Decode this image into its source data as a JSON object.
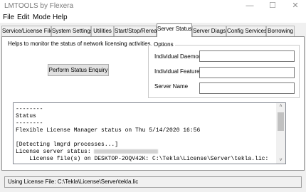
{
  "window": {
    "title": "LMTOOLS by Flexera",
    "minimize_glyph": "—",
    "maximize_glyph": "☐",
    "close_glyph": "✕"
  },
  "menu": [
    "File",
    "Edit",
    "Mode",
    "Help"
  ],
  "tabs": [
    {
      "label": "Service/License File"
    },
    {
      "label": "System Settings"
    },
    {
      "label": "Utilities"
    },
    {
      "label": "Start/Stop/Reread"
    },
    {
      "label": "Server Status",
      "active": true
    },
    {
      "label": "Server Diags"
    },
    {
      "label": "Config Services"
    },
    {
      "label": "Borrowing"
    }
  ],
  "server_status": {
    "description": "Helps to monitor the status of network licensing activities",
    "enquiry_button": "Perform Status Enquiry",
    "options": {
      "legend": "Options",
      "daemon_label": "Individual Daemon",
      "daemon_value": "",
      "feature_label": "Individual Feature",
      "feature_value": "",
      "server_label": "Server Name",
      "server_value": ""
    },
    "output": {
      "line1": "--------",
      "line2": "Status",
      "line3": "--------",
      "line4": "Flexible License Manager status on Thu 5/14/2020 16:56",
      "line5": "",
      "line6": "[Detecting lmgrd processes...]",
      "line7_prefix": "License server status: ",
      "line8": "    License file(s) on DESKTOP-2OQV42K: C:\\Tekla\\License\\Server\\tekla.lic:"
    },
    "scroll_up": "˄",
    "scroll_down": "˅"
  },
  "status_bar": {
    "text": "Using License File:  C:\\Tekla\\License\\Server\\tekla.lic"
  }
}
